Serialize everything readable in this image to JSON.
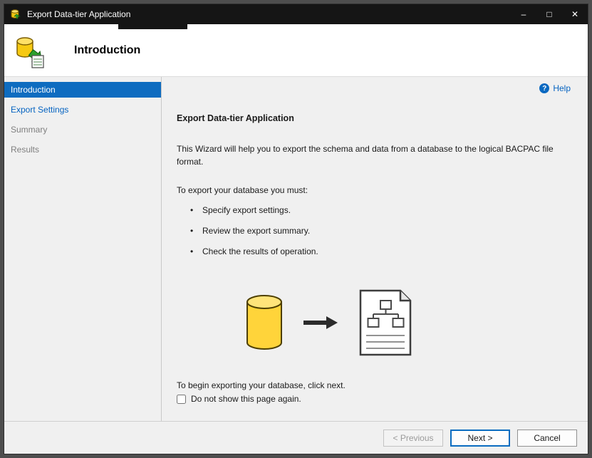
{
  "window": {
    "title": "Export Data-tier Application",
    "controls": {
      "minimize": "–",
      "maximize": "□",
      "close": "✕"
    }
  },
  "header": {
    "title": "Introduction"
  },
  "sidebar": {
    "items": [
      {
        "label": "Introduction",
        "state": "selected"
      },
      {
        "label": "Export Settings",
        "state": "link"
      },
      {
        "label": "Summary",
        "state": "disabled"
      },
      {
        "label": "Results",
        "state": "disabled"
      }
    ]
  },
  "main": {
    "help_icon": "?",
    "help_label": "Help",
    "heading": "Export Data-tier Application",
    "intro": "This Wizard will help you to export the schema and data from a database to the logical BACPAC file format.",
    "must_label": "To export your database you must:",
    "bullets": [
      "Specify export settings.",
      "Review the export summary.",
      "Check the results of operation."
    ],
    "begin_text": "To begin exporting your database, click next.",
    "checkbox_label": "Do not show this page again."
  },
  "footer": {
    "previous_label": "< Previous",
    "next_label": "Next >",
    "cancel_label": "Cancel"
  },
  "colors": {
    "accent": "#0e6cc0",
    "link": "#0563c1",
    "titlebar": "#151515"
  }
}
